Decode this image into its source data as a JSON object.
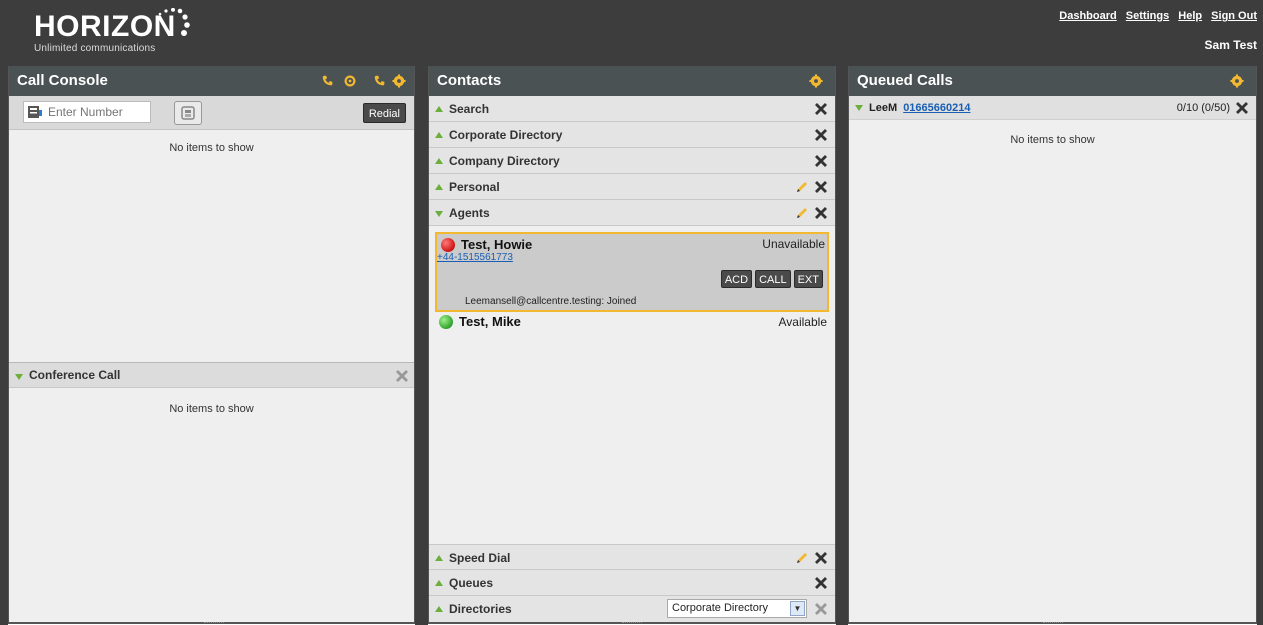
{
  "header": {
    "logo_text": "HORIZON",
    "logo_tagline": "Unlimited communications",
    "links": [
      "Dashboard",
      "Settings",
      "Help",
      "Sign Out"
    ],
    "user_name": "Sam Test"
  },
  "call_console": {
    "title": "Call Console",
    "dial_placeholder": "Enter Number",
    "redial_label": "Redial",
    "empty_text": "No items to show",
    "conference_title": "Conference Call",
    "conference_empty_text": "No items to show"
  },
  "contacts": {
    "title": "Contacts",
    "sections": [
      {
        "label": "Search"
      },
      {
        "label": "Corporate Directory"
      },
      {
        "label": "Company Directory"
      },
      {
        "label": "Personal"
      },
      {
        "label": "Agents"
      }
    ],
    "agents": [
      {
        "name": "Test, Howie",
        "status": "Unavailable",
        "status_color": "#d62020",
        "phone": "+44-1515561773",
        "buttons": [
          "ACD",
          "CALL",
          "EXT"
        ],
        "note": "Leemansell@callcentre.testing: Joined"
      },
      {
        "name": "Test, Mike",
        "status": "Available",
        "status_color": "#3fae3a"
      }
    ],
    "bottom_sections": [
      {
        "label": "Speed Dial"
      },
      {
        "label": "Queues"
      },
      {
        "label": "Directories",
        "select_value": "Corporate Directory"
      }
    ]
  },
  "queued_calls": {
    "title": "Queued Calls",
    "queue_name": "LeeM",
    "queue_number": "01665660214",
    "queue_count": "0/10 (0/50)",
    "empty_text": "No items to show"
  },
  "colors": {
    "header_bg": "#3d3d3d",
    "panel_title_bg": "#4b5254",
    "accent_orange": "#f2b830",
    "expand_green": "#6aaf3a",
    "link_blue": "#1a5fb4"
  }
}
